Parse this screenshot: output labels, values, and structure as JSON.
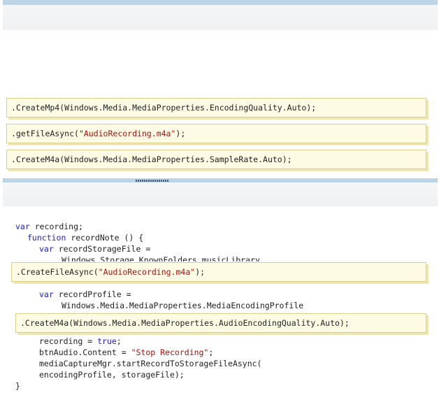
{
  "answers": {
    "a1": ".CreateMp4(Windows.Media.MediaProperties.EncodingQuality.Auto);",
    "a2_pre": ".getFileAsync(",
    "a2_str": "\"AudioRecording.m4a\"",
    "a2_post": ");",
    "a3": ".CreateM4a(Windows.Media.MediaProperties.SampleRate.Auto);"
  },
  "code": {
    "l1_kw": "var",
    "l1_rest": " recording;",
    "l2_kw": "function",
    "l2_rest": " recordNote () {",
    "l3_kw": "var",
    "l3_rest": " recordStorageFile =",
    "l4": "Windows.Storage.KnownFolders.musicLibrary",
    "slot1_pre": ".CreateFileAsync(",
    "slot1_str": "\"AudioRecording.m4a\"",
    "slot1_post": ");",
    "l5_kw": "var",
    "l5_rest": " recordProfile =",
    "l6": "Windows.Media.MediaProperties.MediaEncodingProfile",
    "slot2": ".CreateM4a(Windows.Media.MediaProperties.AudioEncodingQuality.Auto);",
    "l7_pre": "recording = ",
    "l7_kw": "true",
    "l7_post": ";",
    "l8_pre": "btnAudio.Content = ",
    "l8_str": "\"Stop Recording\"",
    "l8_post": ";",
    "l9": "mediaCaptureMgr.startRecordToStorageFileAsync(",
    "l10": "encodingProfile, storageFile);",
    "l11": "}"
  }
}
